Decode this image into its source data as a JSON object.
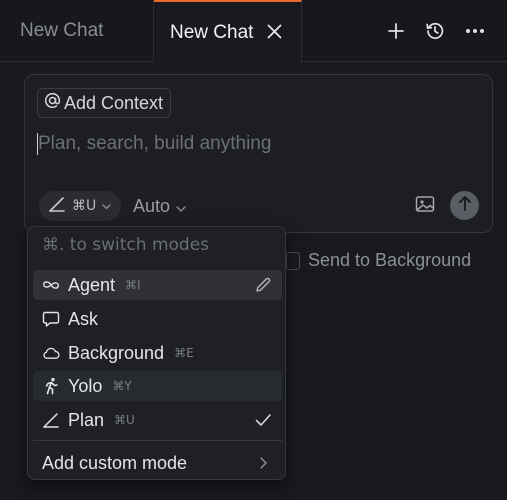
{
  "tabs": [
    {
      "label": "New Chat",
      "active": false
    },
    {
      "label": "New Chat",
      "active": true
    }
  ],
  "tab_close_icon": "close-icon",
  "toolbar": {
    "icons": [
      "plus-icon",
      "history-icon",
      "more-icon"
    ]
  },
  "composer": {
    "add_context_label": "Add Context",
    "placeholder": "Plan, search, build anything",
    "mode_shortcut": "⌘U",
    "model_label": "Auto"
  },
  "send_to_background_label": "Send to Background",
  "mode_menu": {
    "hint": "⌘. to switch modes",
    "items": [
      {
        "label": "Agent",
        "shortcut": "⌘I",
        "icon": "infinity-icon",
        "trailing": "pencil-icon"
      },
      {
        "label": "Ask",
        "shortcut": "",
        "icon": "chat-bubble-icon"
      },
      {
        "label": "Background",
        "shortcut": "⌘E",
        "icon": "cloud-icon"
      },
      {
        "label": "Yolo",
        "shortcut": "⌘Y",
        "icon": "running-person-icon"
      },
      {
        "label": "Plan",
        "shortcut": "⌘U",
        "icon": "ruler-pen-icon",
        "trailing": "checkmark-icon"
      }
    ],
    "custom_label": "Add custom mode"
  },
  "colors": {
    "accent": "#e86a2e",
    "background": "#181a1f",
    "menu": "#1e2025"
  }
}
